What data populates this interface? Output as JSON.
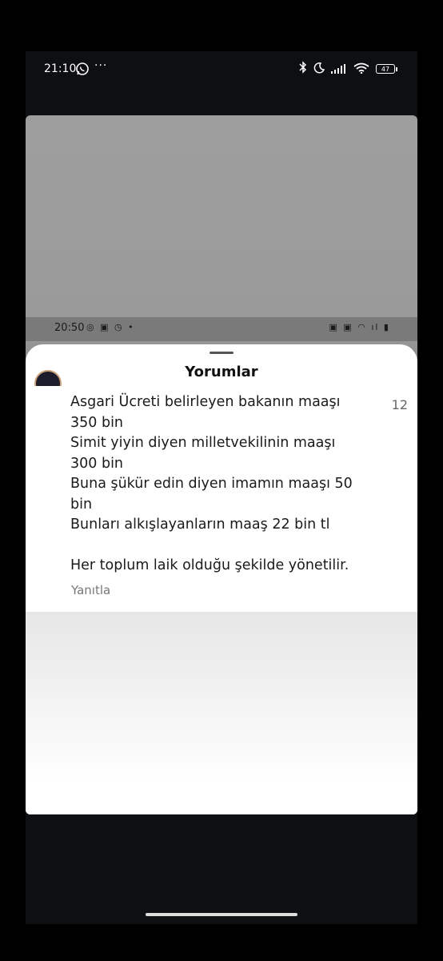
{
  "status_bar": {
    "time": "21:10",
    "overflow": "···",
    "battery": "47",
    "icons": [
      "whatsapp-icon",
      "bluetooth-icon",
      "moon-icon",
      "signal-icon",
      "wifi-icon",
      "battery-icon"
    ]
  },
  "inner_status_bar": {
    "time": "20:50",
    "icons_left": "◎ ▣ ◷ •",
    "icons_right": "▣ ▣ ◠ ıl ▮"
  },
  "comments_sheet": {
    "title": "Yorumlar",
    "comment_text": "Asgari Ücreti belirleyen bakanın maaşı\n350 bin\nSimit yiyin  diyen milletvekilinin maaşı\n300 bin\nBuna şükür edin diyen imamın maaşı 50\nbin\nBunları alkışlayanların maaş 22 bin tl\n\nHer toplum laik olduğu şekilde yönetilir.",
    "like_count": "12",
    "reply_label": "Yanıtla"
  },
  "colors": {
    "outer_background": "#000000",
    "phone_background": "#0e0f13",
    "sheet_background": "#ffffff",
    "secondary_text": "#777777"
  }
}
